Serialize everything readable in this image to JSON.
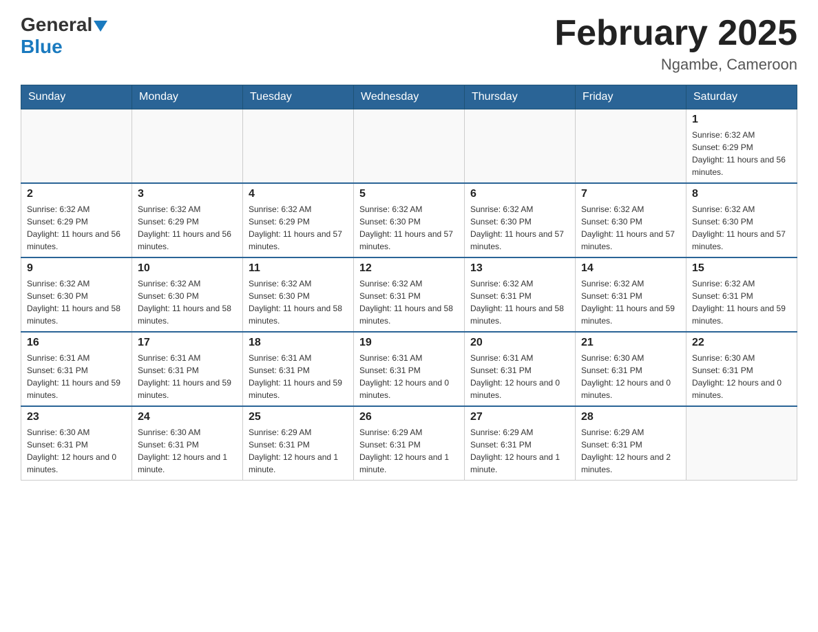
{
  "header": {
    "logo_general": "General",
    "logo_blue": "Blue",
    "title": "February 2025",
    "subtitle": "Ngambe, Cameroon"
  },
  "weekdays": [
    "Sunday",
    "Monday",
    "Tuesday",
    "Wednesday",
    "Thursday",
    "Friday",
    "Saturday"
  ],
  "weeks": [
    {
      "days": [
        {
          "number": "",
          "info": ""
        },
        {
          "number": "",
          "info": ""
        },
        {
          "number": "",
          "info": ""
        },
        {
          "number": "",
          "info": ""
        },
        {
          "number": "",
          "info": ""
        },
        {
          "number": "",
          "info": ""
        },
        {
          "number": "1",
          "info": "Sunrise: 6:32 AM\nSunset: 6:29 PM\nDaylight: 11 hours and 56 minutes."
        }
      ]
    },
    {
      "days": [
        {
          "number": "2",
          "info": "Sunrise: 6:32 AM\nSunset: 6:29 PM\nDaylight: 11 hours and 56 minutes."
        },
        {
          "number": "3",
          "info": "Sunrise: 6:32 AM\nSunset: 6:29 PM\nDaylight: 11 hours and 56 minutes."
        },
        {
          "number": "4",
          "info": "Sunrise: 6:32 AM\nSunset: 6:29 PM\nDaylight: 11 hours and 57 minutes."
        },
        {
          "number": "5",
          "info": "Sunrise: 6:32 AM\nSunset: 6:30 PM\nDaylight: 11 hours and 57 minutes."
        },
        {
          "number": "6",
          "info": "Sunrise: 6:32 AM\nSunset: 6:30 PM\nDaylight: 11 hours and 57 minutes."
        },
        {
          "number": "7",
          "info": "Sunrise: 6:32 AM\nSunset: 6:30 PM\nDaylight: 11 hours and 57 minutes."
        },
        {
          "number": "8",
          "info": "Sunrise: 6:32 AM\nSunset: 6:30 PM\nDaylight: 11 hours and 57 minutes."
        }
      ]
    },
    {
      "days": [
        {
          "number": "9",
          "info": "Sunrise: 6:32 AM\nSunset: 6:30 PM\nDaylight: 11 hours and 58 minutes."
        },
        {
          "number": "10",
          "info": "Sunrise: 6:32 AM\nSunset: 6:30 PM\nDaylight: 11 hours and 58 minutes."
        },
        {
          "number": "11",
          "info": "Sunrise: 6:32 AM\nSunset: 6:30 PM\nDaylight: 11 hours and 58 minutes."
        },
        {
          "number": "12",
          "info": "Sunrise: 6:32 AM\nSunset: 6:31 PM\nDaylight: 11 hours and 58 minutes."
        },
        {
          "number": "13",
          "info": "Sunrise: 6:32 AM\nSunset: 6:31 PM\nDaylight: 11 hours and 58 minutes."
        },
        {
          "number": "14",
          "info": "Sunrise: 6:32 AM\nSunset: 6:31 PM\nDaylight: 11 hours and 59 minutes."
        },
        {
          "number": "15",
          "info": "Sunrise: 6:32 AM\nSunset: 6:31 PM\nDaylight: 11 hours and 59 minutes."
        }
      ]
    },
    {
      "days": [
        {
          "number": "16",
          "info": "Sunrise: 6:31 AM\nSunset: 6:31 PM\nDaylight: 11 hours and 59 minutes."
        },
        {
          "number": "17",
          "info": "Sunrise: 6:31 AM\nSunset: 6:31 PM\nDaylight: 11 hours and 59 minutes."
        },
        {
          "number": "18",
          "info": "Sunrise: 6:31 AM\nSunset: 6:31 PM\nDaylight: 11 hours and 59 minutes."
        },
        {
          "number": "19",
          "info": "Sunrise: 6:31 AM\nSunset: 6:31 PM\nDaylight: 12 hours and 0 minutes."
        },
        {
          "number": "20",
          "info": "Sunrise: 6:31 AM\nSunset: 6:31 PM\nDaylight: 12 hours and 0 minutes."
        },
        {
          "number": "21",
          "info": "Sunrise: 6:30 AM\nSunset: 6:31 PM\nDaylight: 12 hours and 0 minutes."
        },
        {
          "number": "22",
          "info": "Sunrise: 6:30 AM\nSunset: 6:31 PM\nDaylight: 12 hours and 0 minutes."
        }
      ]
    },
    {
      "days": [
        {
          "number": "23",
          "info": "Sunrise: 6:30 AM\nSunset: 6:31 PM\nDaylight: 12 hours and 0 minutes."
        },
        {
          "number": "24",
          "info": "Sunrise: 6:30 AM\nSunset: 6:31 PM\nDaylight: 12 hours and 1 minute."
        },
        {
          "number": "25",
          "info": "Sunrise: 6:29 AM\nSunset: 6:31 PM\nDaylight: 12 hours and 1 minute."
        },
        {
          "number": "26",
          "info": "Sunrise: 6:29 AM\nSunset: 6:31 PM\nDaylight: 12 hours and 1 minute."
        },
        {
          "number": "27",
          "info": "Sunrise: 6:29 AM\nSunset: 6:31 PM\nDaylight: 12 hours and 1 minute."
        },
        {
          "number": "28",
          "info": "Sunrise: 6:29 AM\nSunset: 6:31 PM\nDaylight: 12 hours and 2 minutes."
        },
        {
          "number": "",
          "info": ""
        }
      ]
    }
  ]
}
